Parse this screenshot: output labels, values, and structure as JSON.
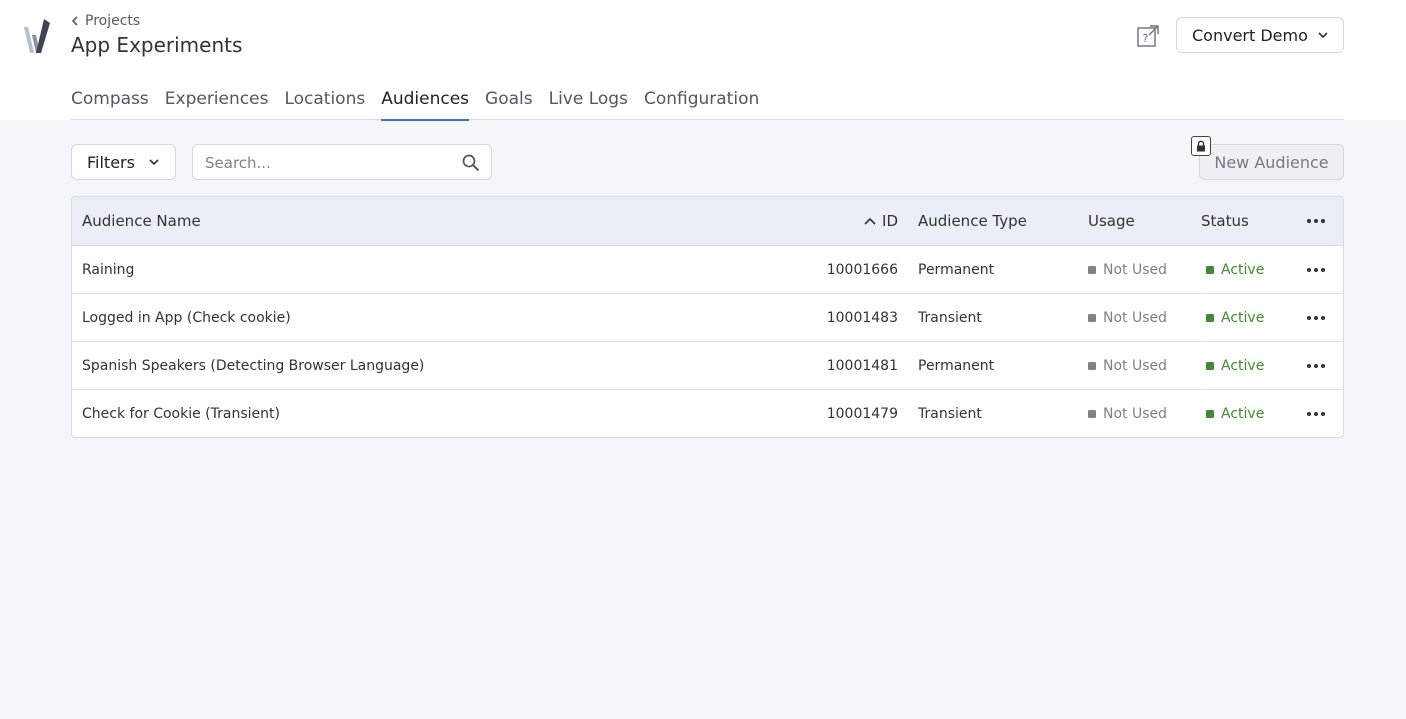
{
  "header": {
    "breadcrumb": "Projects",
    "title": "App Experiments",
    "account": "Convert Demo"
  },
  "tabs": [
    {
      "label": "Compass",
      "active": false
    },
    {
      "label": "Experiences",
      "active": false
    },
    {
      "label": "Locations",
      "active": false
    },
    {
      "label": "Audiences",
      "active": true
    },
    {
      "label": "Goals",
      "active": false
    },
    {
      "label": "Live Logs",
      "active": false
    },
    {
      "label": "Configuration",
      "active": false
    }
  ],
  "toolbar": {
    "filters_label": "Filters",
    "search_placeholder": "Search...",
    "new_label": "New Audience"
  },
  "table": {
    "columns": {
      "name": "Audience Name",
      "id": "ID",
      "type": "Audience Type",
      "usage": "Usage",
      "status": "Status"
    },
    "rows": [
      {
        "name": "Raining",
        "id": "10001666",
        "type": "Permanent",
        "usage": "Not Used",
        "status": "Active"
      },
      {
        "name": "Logged in App (Check cookie)",
        "id": "10001483",
        "type": "Transient",
        "usage": "Not Used",
        "status": "Active"
      },
      {
        "name": "Spanish Speakers (Detecting Browser Language)",
        "id": "10001481",
        "type": "Permanent",
        "usage": "Not Used",
        "status": "Active"
      },
      {
        "name": "Check for Cookie (Transient)",
        "id": "10001479",
        "type": "Transient",
        "usage": "Not Used",
        "status": "Active"
      }
    ]
  },
  "colors": {
    "accent": "#3b6ed6",
    "active_status": "#3f8c2e",
    "usage_dot": "#7d838c"
  },
  "icons": [
    "logo-icon",
    "chevron-left-icon",
    "help-external-icon",
    "chevron-down-icon",
    "search-icon",
    "lock-icon",
    "sort-up-icon",
    "more-horizontal-icon"
  ]
}
